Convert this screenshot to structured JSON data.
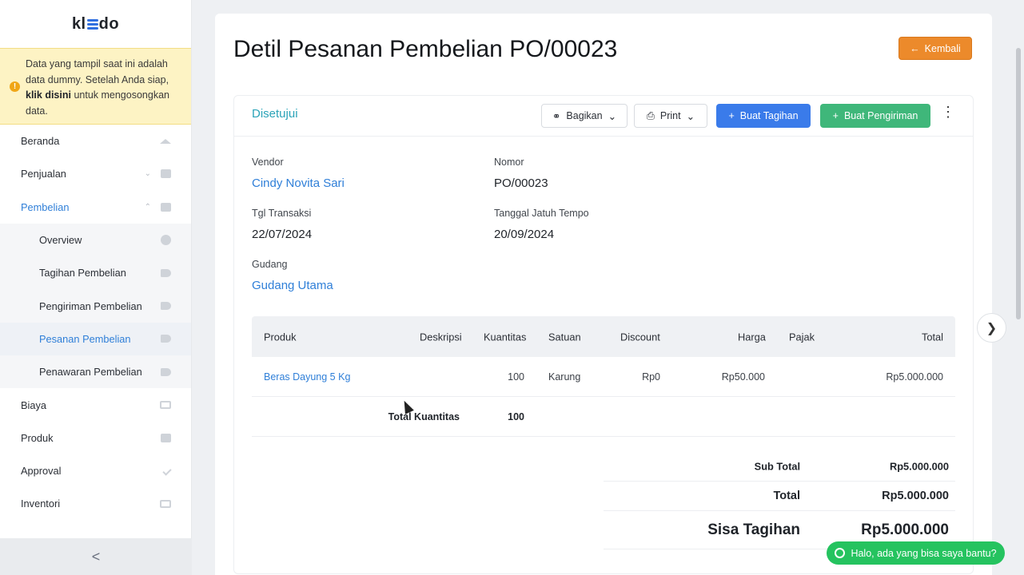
{
  "brand": {
    "logo_left": "kl",
    "logo_right": "do"
  },
  "notice": {
    "text_before": "Data yang tampil saat ini adalah data dummy. Setelah Anda siap, ",
    "link": "klik disini",
    "text_after": " untuk mengosongkan data."
  },
  "sidebar": {
    "items": [
      {
        "label": "Beranda",
        "icon": "home-icon"
      },
      {
        "label": "Penjualan",
        "icon": "basket-icon"
      },
      {
        "label": "Pembelian",
        "icon": "bag-icon"
      },
      {
        "label": "Biaya",
        "icon": "card-icon"
      },
      {
        "label": "Produk",
        "icon": "box-icon"
      },
      {
        "label": "Approval",
        "icon": "check-icon"
      },
      {
        "label": "Inventori",
        "icon": "warehouse-icon"
      }
    ],
    "submenu": [
      {
        "label": "Overview",
        "icon": "pie-icon"
      },
      {
        "label": "Tagihan Pembelian",
        "icon": "tag-icon"
      },
      {
        "label": "Pengiriman Pembelian",
        "icon": "tag-icon"
      },
      {
        "label": "Pesanan Pembelian",
        "icon": "tag-icon"
      },
      {
        "label": "Penawaran Pembelian",
        "icon": "tag-icon"
      }
    ],
    "collapse": "<"
  },
  "page": {
    "title": "Detil Pesanan Pembelian PO/00023",
    "back_label": "Kembali"
  },
  "toolbar": {
    "status": "Disetujui",
    "share_label": "Bagikan",
    "print_label": "Print",
    "create_bill_label": "Buat Tagihan",
    "create_shipment_label": "Buat Pengiriman"
  },
  "details": {
    "vendor_label": "Vendor",
    "vendor_value": "Cindy Novita Sari",
    "number_label": "Nomor",
    "number_value": "PO/00023",
    "date_label": "Tgl Transaksi",
    "date_value": "22/07/2024",
    "due_label": "Tanggal Jatuh Tempo",
    "due_value": "20/09/2024",
    "warehouse_label": "Gudang",
    "warehouse_value": "Gudang Utama"
  },
  "table": {
    "headers": {
      "product": "Produk",
      "description": "Deskripsi",
      "quantity": "Kuantitas",
      "unit": "Satuan",
      "discount": "Discount",
      "price": "Harga",
      "tax": "Pajak",
      "total": "Total"
    },
    "rows": [
      {
        "product": "Beras Dayung 5 Kg",
        "description": "",
        "quantity": "100",
        "unit": "Karung",
        "discount": "Rp0",
        "price": "Rp50.000",
        "tax": "",
        "total": "Rp5.000.000"
      }
    ],
    "total_quantity_label": "Total Kuantitas",
    "total_quantity_value": "100"
  },
  "summary": {
    "subtotal_label": "Sub Total",
    "subtotal_value": "Rp5.000.000",
    "total_label": "Total",
    "total_value": "Rp5.000.000",
    "balance_label": "Sisa Tagihan",
    "balance_value": "Rp5.000.000"
  },
  "chat": {
    "label": "Halo, ada yang bisa saya bantu?"
  },
  "colors": {
    "accent": "#2f7fd8",
    "status": "#2aa3b8",
    "back_button": "#ec8a2b",
    "bill_button": "#3a7bea",
    "shipment_button": "#3fb77a",
    "chat": "#25c35f",
    "notice_bg": "#fdf3c4"
  }
}
